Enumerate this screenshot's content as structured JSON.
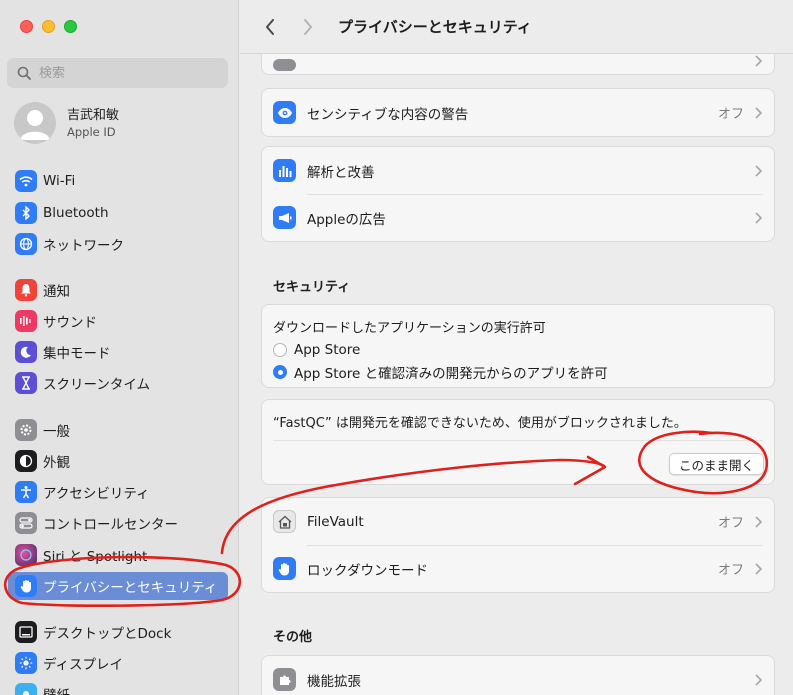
{
  "window": {
    "title": "プライバシーとセキュリティ"
  },
  "search": {
    "placeholder": "検索"
  },
  "user": {
    "name": "吉武和敏",
    "subtitle": "Apple ID"
  },
  "sidebar": {
    "items": [
      {
        "label": "Wi-Fi",
        "icon": "wifi-icon",
        "color": "#2f7cf6"
      },
      {
        "label": "Bluetooth",
        "icon": "bluetooth-icon",
        "color": "#2f7cf6"
      },
      {
        "label": "ネットワーク",
        "icon": "globe-icon",
        "color": "#2f7cf6"
      },
      {
        "label": "通知",
        "icon": "bell-icon",
        "color": "#f0443a"
      },
      {
        "label": "サウンド",
        "icon": "speaker-icon",
        "color": "#ee3a63"
      },
      {
        "label": "集中モード",
        "icon": "moon-icon",
        "color": "#5b4fd6"
      },
      {
        "label": "スクリーンタイム",
        "icon": "hourglass-icon",
        "color": "#5b4fd6"
      },
      {
        "label": "一般",
        "icon": "gear-icon",
        "color": "#8e8e93"
      },
      {
        "label": "外観",
        "icon": "appearance-icon",
        "color": "#1d1d1f"
      },
      {
        "label": "アクセシビリティ",
        "icon": "accessibility-icon",
        "color": "#2f7cf6"
      },
      {
        "label": "コントロールセンター",
        "icon": "toggles-icon",
        "color": "#8e8e93"
      },
      {
        "label": "Siri と Spotlight",
        "icon": "siri-icon",
        "color": "#3b2f6a"
      },
      {
        "label": "プライバシーとセキュリティ",
        "icon": "hand-icon",
        "color": "#2f7cf6"
      },
      {
        "label": "デスクトップとDock",
        "icon": "desktop-icon",
        "color": "#1d1d1f"
      },
      {
        "label": "ディスプレイ",
        "icon": "sun-icon",
        "color": "#2f7cf6"
      },
      {
        "label": "壁紙",
        "icon": "wallpaper-icon",
        "color": "#3ab0f0"
      }
    ],
    "active_index": 12
  },
  "main": {
    "partial_row": {
      "label": ""
    },
    "card_sensitive": {
      "label": "センシティブな内容の警告",
      "value": "オフ"
    },
    "card_analytics": [
      {
        "label": "解析と改善"
      },
      {
        "label": "Appleの広告"
      }
    ],
    "security_header": "セキュリティ",
    "download_card": {
      "title": "ダウンロードしたアプリケーションの実行許可",
      "options": [
        {
          "label": "App Store",
          "selected": false
        },
        {
          "label": "App Store と確認済みの開発元からのアプリを許可",
          "selected": true
        }
      ]
    },
    "blocked_card": {
      "message": "“FastQC” は開発元を確認できないため、使用がブロックされました。",
      "button": "このまま開く"
    },
    "security_rows": [
      {
        "label": "FileVault",
        "value": "オフ"
      },
      {
        "label": "ロックダウンモード",
        "value": "オフ"
      }
    ],
    "other_header": "その他",
    "extensions_row": {
      "label": "機能拡張"
    }
  },
  "colors": {
    "accent": "#2f7cf6",
    "sidebar_active": "#6a8dd6",
    "annotation": "#e0201b"
  }
}
